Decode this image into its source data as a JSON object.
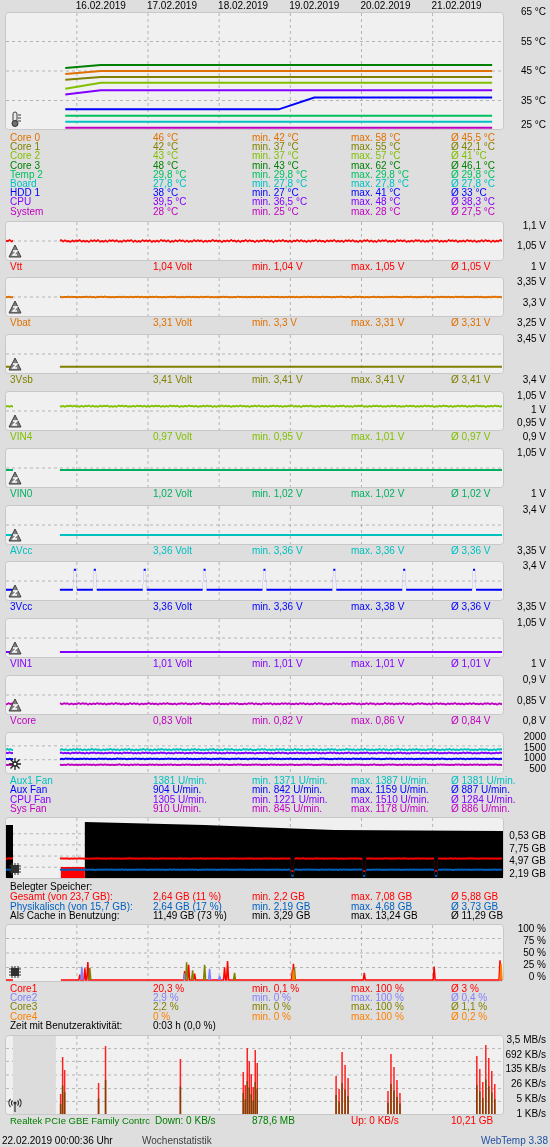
{
  "temperatures": {
    "chart_data": {
      "type": "line",
      "grid": true,
      "ylim": [
        25,
        65
      ],
      "yticks": [
        {
          "value": 65,
          "label": "65 °C"
        },
        {
          "value": 55,
          "label": "55 °C"
        },
        {
          "value": 45,
          "label": "45 °C"
        },
        {
          "value": 35,
          "label": "35 °C"
        },
        {
          "value": 25,
          "label": "25 °C"
        }
      ],
      "categories": [
        null,
        null,
        "16.02.2019",
        null,
        "17.02.2019",
        null,
        "18.02.2019",
        null,
        "19.02.2019",
        null,
        "20.02.2019",
        null,
        "21.02.2019",
        null
      ],
      "series": [
        {
          "name": "Core 0",
          "color": "#e07000",
          "values": [
            null,
            44,
            45,
            45,
            45,
            45,
            45,
            45,
            45,
            45,
            45,
            45,
            45,
            45
          ]
        },
        {
          "name": "Core 1",
          "color": "#808000",
          "values": [
            null,
            42,
            43,
            43,
            43,
            43,
            43,
            43,
            43,
            43,
            43,
            43,
            43,
            43
          ]
        },
        {
          "name": "Core 2",
          "color": "#80c000",
          "values": [
            null,
            39,
            41,
            41,
            41,
            41,
            41,
            41,
            41,
            41,
            41,
            41,
            41,
            41
          ]
        },
        {
          "name": "Core 3",
          "color": "#008000",
          "values": [
            null,
            46,
            47,
            47,
            47,
            47,
            47,
            47,
            47,
            47,
            47,
            47,
            47,
            47
          ]
        },
        {
          "name": "Temp 2",
          "color": "#00c060",
          "values": [
            null,
            29.8,
            29.8,
            29.8,
            29.8,
            29.8,
            29.8,
            29.8,
            29.8,
            29.8,
            29.8,
            29.8,
            29.8,
            29.8
          ]
        },
        {
          "name": "Board",
          "color": "#00c0c0",
          "values": [
            null,
            27.8,
            27.8,
            27.8,
            27.8,
            27.8,
            27.8,
            27.8,
            27.8,
            27.8,
            27.8,
            27.8,
            27.8,
            27.8
          ]
        },
        {
          "name": "HDD 1",
          "color": "#0000ff",
          "values": [
            null,
            32,
            32,
            32,
            32,
            32,
            32,
            32,
            36,
            36,
            36,
            36,
            36,
            36
          ]
        },
        {
          "name": "CPU",
          "color": "#8000ff",
          "values": [
            null,
            37,
            38.5,
            38.5,
            38.5,
            38.5,
            38.5,
            38.5,
            38.5,
            38.5,
            38.5,
            38.5,
            38.5,
            38.5
          ]
        },
        {
          "name": "System",
          "color": "#c000c0",
          "values": [
            null,
            25.8,
            25.8,
            25.8,
            25.8,
            25.8,
            25.8,
            25.8,
            25.8,
            25.8,
            25.8,
            25.8,
            25.8,
            25.8
          ]
        }
      ]
    },
    "sensors": [
      {
        "value": "46 °C",
        "min": "min. 42 °C",
        "max": "max. 58 °C",
        "avg": "Ø 45,5 °C"
      },
      {
        "value": "42 °C",
        "min": "min. 37 °C",
        "max": "max. 55 °C",
        "avg": "Ø 42,1 °C"
      },
      {
        "value": "43 °C",
        "min": "min. 37 °C",
        "max": "max. 57 °C",
        "avg": "Ø 41 °C"
      },
      {
        "value": "48 °C",
        "min": "min. 43 °C",
        "max": "max. 62 °C",
        "avg": "Ø 46,1 °C"
      },
      {
        "value": "29,8 °C",
        "min": "min. 29,8 °C",
        "max": "max. 29,8 °C",
        "avg": "Ø 29,8 °C"
      },
      {
        "value": "27,8 °C",
        "min": "min. 27,8 °C",
        "max": "max. 27,8 °C",
        "avg": "Ø 27,8 °C"
      },
      {
        "value": "38 °C",
        "min": "min. 27 °C",
        "max": "max. 41 °C",
        "avg": "Ø 33 °C"
      },
      {
        "value": "39,5 °C",
        "min": "min. 36,5 °C",
        "max": "max. 48 °C",
        "avg": "Ø 38,3 °C"
      },
      {
        "value": "28 °C",
        "min": "min. 25 °C",
        "max": "max. 28 °C",
        "avg": "Ø 27,5 °C"
      }
    ]
  },
  "voltages": [
    {
      "name": "Vtt",
      "value": "1,04 Volt",
      "min": "min. 1,04 V",
      "max": "max. 1,05 V",
      "avg": "Ø 1,05 V",
      "color": "#ff0000",
      "ticks": [
        "1,1 V",
        "1,05 V",
        "1 V"
      ]
    },
    {
      "name": "Vbat",
      "value": "3,31 Volt",
      "min": "min. 3,3 V",
      "max": "max. 3,31 V",
      "avg": "Ø 3,31 V",
      "color": "#e07000",
      "ticks": [
        "3,35 V",
        "3,3 V",
        "3,25 V"
      ]
    },
    {
      "name": "3Vsb",
      "value": "3,41 Volt",
      "min": "min. 3,41 V",
      "max": "max. 3,41 V",
      "avg": "Ø 3,41 V",
      "color": "#808000",
      "ticks": [
        "3,45 V",
        "3,4 V"
      ]
    },
    {
      "name": "VIN4",
      "value": "0,97 Volt",
      "min": "min. 0,95 V",
      "max": "max. 1,01 V",
      "avg": "Ø 0,97 V",
      "color": "#80c000",
      "ticks": [
        "1,05 V",
        "1 V",
        "0,95 V",
        "0,9 V"
      ]
    },
    {
      "name": "VIN0",
      "value": "1,02 Volt",
      "min": "min. 1,02 V",
      "max": "max. 1,02 V",
      "avg": "Ø 1,02 V",
      "color": "#00b060",
      "ticks": [
        "1,05 V",
        "1 V"
      ]
    },
    {
      "name": "AVcc",
      "value": "3,36 Volt",
      "min": "min. 3,36 V",
      "max": "max. 3,36 V",
      "avg": "Ø 3,36 V",
      "color": "#00c0c0",
      "ticks": [
        "3,4 V",
        "3,35 V"
      ]
    },
    {
      "name": "3Vcc",
      "value": "3,36 Volt",
      "min": "min. 3,36 V",
      "max": "max. 3,38 V",
      "avg": "Ø 3,36 V",
      "color": "#0000ff",
      "ticks": [
        "3,4 V",
        "3,35 V"
      ]
    },
    {
      "name": "VIN1",
      "value": "1,01 Volt",
      "min": "min. 1,01 V",
      "max": "max. 1,01 V",
      "avg": "Ø 1,01 V",
      "color": "#8000ff",
      "ticks": [
        "1,05 V",
        "1 V"
      ]
    },
    {
      "name": "Vcore",
      "value": "0,83 Volt",
      "min": "min. 0,82 V",
      "max": "max. 0,86 V",
      "avg": "Ø 0,84 V",
      "color": "#c000c0",
      "ticks": [
        "0,9 V",
        "0,85 V",
        "0,8 V"
      ]
    }
  ],
  "fans": {
    "ticks": [
      "2000",
      "1500",
      "1000",
      "500"
    ],
    "sensors": [
      {
        "name": "Aux1 Fan",
        "value": "1381 U/min.",
        "min": "min. 1371 U/min.",
        "max": "max. 1387 U/min.",
        "avg": "Ø 1381 U/min.",
        "color": "#00c0c0"
      },
      {
        "name": "Aux Fan",
        "value": "904 U/min.",
        "min": "min. 842 U/min.",
        "max": "max. 1159 U/min.",
        "avg": "Ø 887 U/min.",
        "color": "#0000ff"
      },
      {
        "name": "CPU Fan",
        "value": "1305 U/min.",
        "min": "min. 1221 U/min.",
        "max": "max. 1510 U/min.",
        "avg": "Ø 1284 U/min.",
        "color": "#8000ff"
      },
      {
        "name": "Sys Fan",
        "value": "910 U/min.",
        "min": "min. 845 U/min.",
        "max": "max. 1178 U/min.",
        "avg": "Ø 886 U/min.",
        "color": "#c000c0"
      }
    ]
  },
  "memory": {
    "ticks": [
      "0,53 GB",
      "7,75 GB",
      "4,97 GB",
      "2,19 GB"
    ],
    "heading": "Belegter Speicher:",
    "rows": [
      {
        "name": "Gesamt (von 23,7 GB):",
        "value": "2,64 GB (11 %)",
        "min": "min. 2,2 GB",
        "max": "max. 7,08 GB",
        "avg": "Ø 5,88 GB",
        "color": "#ff0000"
      },
      {
        "name": "Physikalisch (von 15,7 GB):",
        "value": "2,64 GB (17 %)",
        "min": "min. 2,19 GB",
        "max": "max. 4,68 GB",
        "avg": "Ø 3,73 GB",
        "color": "#0060c0"
      },
      {
        "name": "Als Cache in Benutzung:",
        "value": "11,49 GB (73 %)",
        "min": "min. 3,29 GB",
        "max": "max. 13,24 GB",
        "avg": "Ø 11,29 GB",
        "color": "#000000"
      }
    ]
  },
  "cpu": {
    "ticks": [
      "100 %",
      "75 %",
      "50 %",
      "25 %",
      "0 %"
    ],
    "cores": [
      {
        "name": "Core1",
        "value": "20,3 %",
        "min": "min. 0,1 %",
        "max": "max. 100 %",
        "avg": "Ø 3 %",
        "color": "#ff0000"
      },
      {
        "name": "Core2",
        "value": "2,9 %",
        "min": "min. 0 %",
        "max": "max. 100 %",
        "avg": "Ø 0,4 %",
        "color": "#8080ff"
      },
      {
        "name": "Core3",
        "value": "2,2 %",
        "min": "min. 0 %",
        "max": "max. 100 %",
        "avg": "Ø 1,1 %",
        "color": "#808000"
      },
      {
        "name": "Core4",
        "value": "0 %",
        "min": "min. 0 %",
        "max": "max. 100 %",
        "avg": "Ø 0,2 %",
        "color": "#ff8000"
      }
    ],
    "activity": {
      "label": "Zeit mit Benutzeraktivität:",
      "value": "0:03 h (0,0 %)"
    }
  },
  "network": {
    "ticks": [
      "3,5 MB/s",
      "692 KB/s",
      "135 KB/s",
      "26 KB/s",
      "5 KB/s",
      "1 KB/s"
    ],
    "adapter": "Realtek PCIe GBE Family Contrc",
    "down": "Down: 0 KB/s",
    "down_total": "878,6 MB",
    "up": "Up: 0 KB/s",
    "up_total": "10,21 GB"
  },
  "footer": {
    "timestamp": "22.02.2019 00:00:36 Uhr",
    "link": "Wochenstatistik",
    "version": "WebTemp 3.38"
  }
}
